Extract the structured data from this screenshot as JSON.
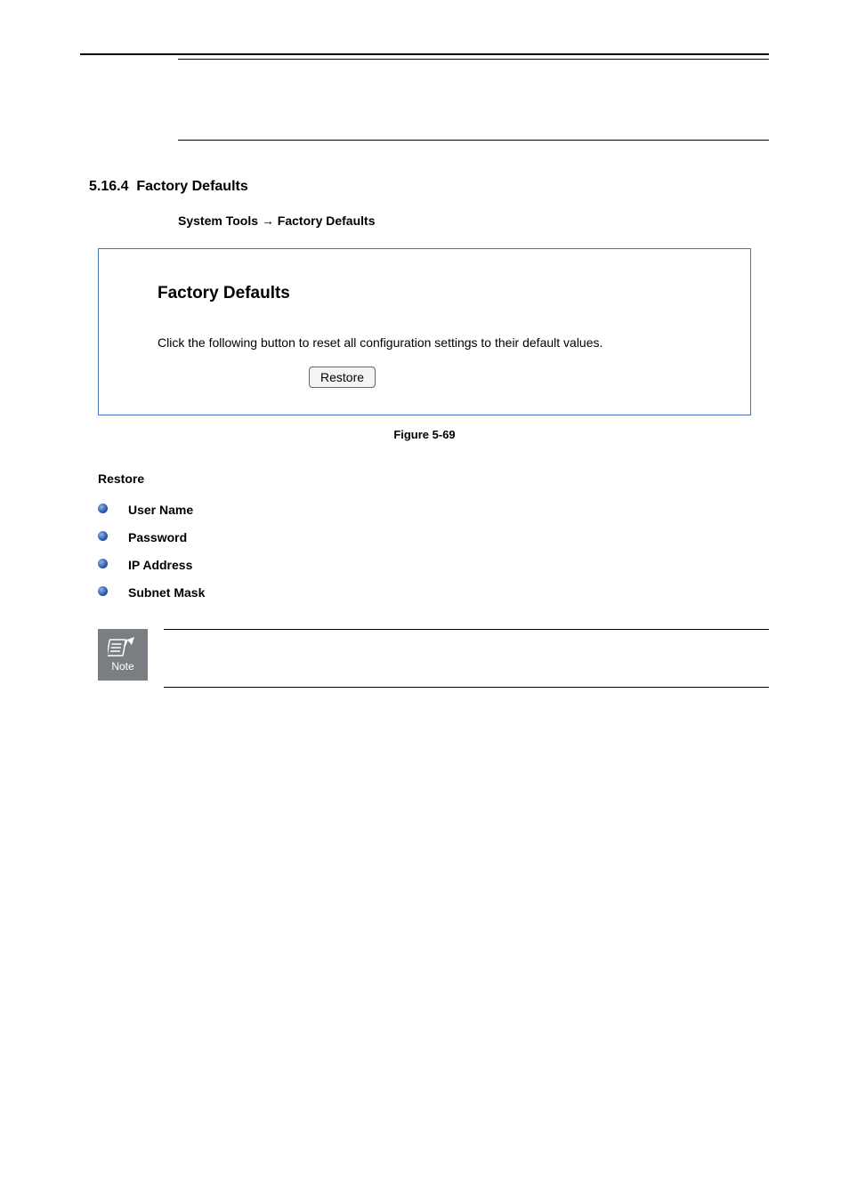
{
  "section": {
    "number": "5.16.4",
    "title": "Factory Defaults"
  },
  "nav_path": {
    "prefix": "System Tools",
    "arrow": "→",
    "suffix": "Factory Defaults"
  },
  "figure": {
    "title": "Factory Defaults",
    "instruction": "Click the following button to reset all configuration settings to their default values.",
    "button": "Restore",
    "caption": "Figure 5-69"
  },
  "restore_word": "Restore",
  "defaults": [
    {
      "label": "User Name"
    },
    {
      "label": "Password"
    },
    {
      "label": "IP Address"
    },
    {
      "label": "Subnet Mask"
    }
  ],
  "note_label": "Note"
}
